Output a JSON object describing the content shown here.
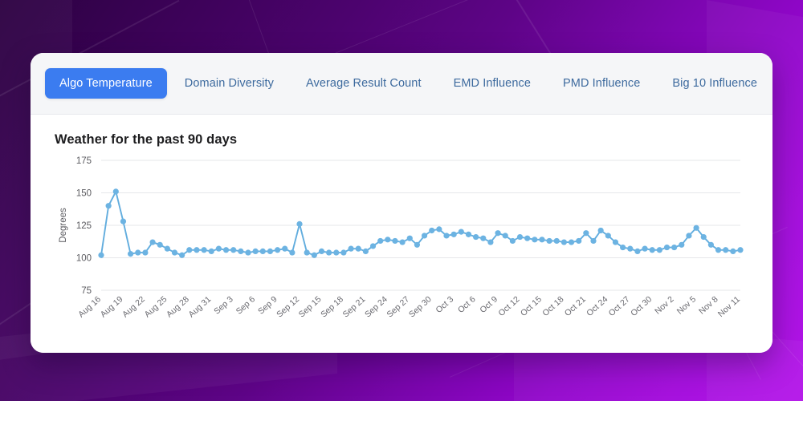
{
  "window": {
    "background_colors": [
      "#2b0140",
      "#5e0487",
      "#b10ae8"
    ]
  },
  "card": {
    "tabs": [
      {
        "label": "Algo Temperature",
        "active": true
      },
      {
        "label": "Domain Diversity",
        "active": false
      },
      {
        "label": "Average Result Count",
        "active": false
      },
      {
        "label": "EMD Influence",
        "active": false
      },
      {
        "label": "PMD Influence",
        "active": false
      },
      {
        "label": "Big 10 Influence",
        "active": false
      }
    ],
    "active_tab_color": "#3b7cf0",
    "tab_text_color": "#3d6a9e"
  },
  "chart_data": {
    "type": "line",
    "title": "Weather for the past 90 days",
    "xlabel": "",
    "ylabel": "Degrees",
    "ylim": [
      75,
      175
    ],
    "yticks": [
      75,
      100,
      125,
      150,
      175
    ],
    "grid": true,
    "legend": "none",
    "series_color": "#6cb3e2",
    "marker": "circle",
    "xtick_step": 3,
    "x": [
      "Aug 16",
      "Aug 17",
      "Aug 18",
      "Aug 19",
      "Aug 20",
      "Aug 21",
      "Aug 22",
      "Aug 23",
      "Aug 24",
      "Aug 25",
      "Aug 26",
      "Aug 27",
      "Aug 28",
      "Aug 29",
      "Aug 30",
      "Aug 31",
      "Sep 1",
      "Sep 2",
      "Sep 3",
      "Sep 4",
      "Sep 5",
      "Sep 6",
      "Sep 7",
      "Sep 8",
      "Sep 9",
      "Sep 10",
      "Sep 11",
      "Sep 12",
      "Sep 13",
      "Sep 14",
      "Sep 15",
      "Sep 16",
      "Sep 17",
      "Sep 18",
      "Sep 19",
      "Sep 20",
      "Sep 21",
      "Sep 22",
      "Sep 23",
      "Sep 24",
      "Sep 25",
      "Sep 26",
      "Sep 27",
      "Sep 28",
      "Sep 29",
      "Sep 30",
      "Oct 1",
      "Oct 2",
      "Oct 3",
      "Oct 4",
      "Oct 5",
      "Oct 6",
      "Oct 7",
      "Oct 8",
      "Oct 9",
      "Oct 10",
      "Oct 11",
      "Oct 12",
      "Oct 13",
      "Oct 14",
      "Oct 15",
      "Oct 16",
      "Oct 17",
      "Oct 18",
      "Oct 19",
      "Oct 20",
      "Oct 21",
      "Oct 22",
      "Oct 23",
      "Oct 24",
      "Oct 25",
      "Oct 26",
      "Oct 27",
      "Oct 28",
      "Oct 29",
      "Oct 30",
      "Oct 31",
      "Nov 1",
      "Nov 2",
      "Nov 3",
      "Nov 4",
      "Nov 5",
      "Nov 6",
      "Nov 7",
      "Nov 8",
      "Nov 9",
      "Nov 10",
      "Nov 11"
    ],
    "values": [
      102,
      140,
      151,
      128,
      103,
      104,
      104,
      112,
      110,
      107,
      104,
      102,
      106,
      106,
      106,
      105,
      107,
      106,
      106,
      105,
      104,
      105,
      105,
      105,
      106,
      107,
      104,
      126,
      104,
      102,
      105,
      104,
      104,
      104,
      107,
      107,
      105,
      109,
      113,
      114,
      113,
      112,
      115,
      110,
      117,
      121,
      122,
      117,
      118,
      120,
      118,
      116,
      115,
      112,
      119,
      117,
      113,
      116,
      115,
      114,
      114,
      113,
      113,
      112,
      112,
      113,
      119,
      113,
      121,
      117,
      112,
      108,
      107,
      105,
      107,
      106,
      106,
      108,
      108,
      110,
      117,
      123,
      116,
      110,
      106,
      106,
      105,
      106
    ]
  }
}
